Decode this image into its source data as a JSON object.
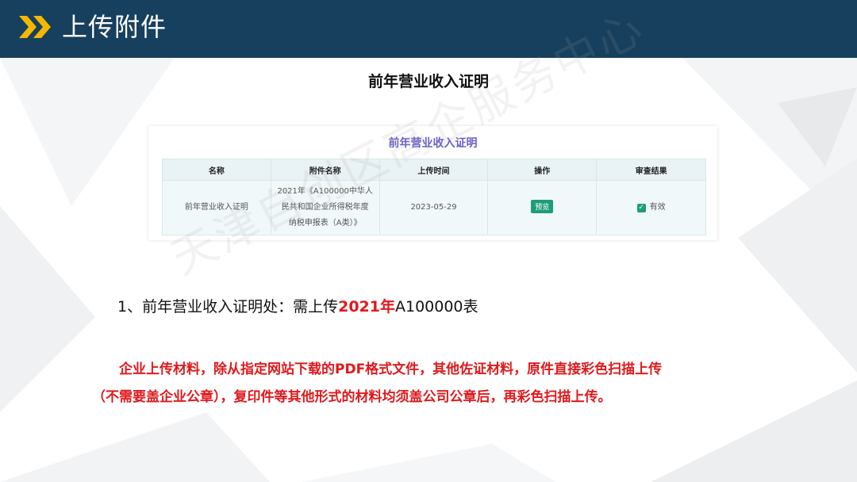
{
  "header": {
    "title": "上传附件",
    "icon": "double-chevron-icon",
    "bg_color": "#17405e",
    "accent_color": "#f5b800"
  },
  "page_title": "前年营业收入证明",
  "screenshot": {
    "title": "前年营业收入证明",
    "columns": [
      "名称",
      "附件名称",
      "上传时间",
      "操作",
      "审查结果"
    ],
    "row": {
      "name": "前年营业收入证明",
      "attachment_lines": [
        "2021年《A100000中华人",
        "民共和国企业所得税年度",
        "纳税申报表（A类）》"
      ],
      "upload_time": "2023-05-29",
      "action_label": "预览",
      "result_label": "有效"
    }
  },
  "step": {
    "prefix": "1、前年营业收入证明处：需上传",
    "highlight": "2021年",
    "suffix": "A100000表"
  },
  "notice": {
    "line1": "企业上传材料，除从指定网站下载的PDF格式文件，其他佐证材料，原件直接彩色扫描上传",
    "line2": "（不需要盖企业公章），复印件等其他形式的材料均须盖公司公章后，再彩色扫描上传。"
  },
  "watermark": "天津自创区高企服务中心",
  "colors": {
    "highlight_red": "#e0191c",
    "table_title_purple": "#6b5fc7",
    "button_green": "#1e9d7a"
  }
}
